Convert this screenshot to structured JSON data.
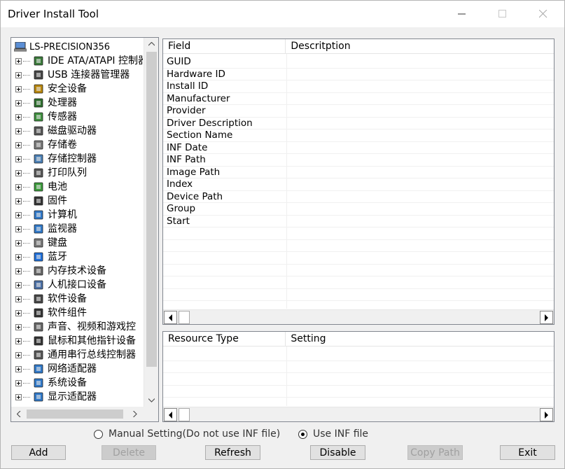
{
  "window": {
    "title": "Driver Install Tool"
  },
  "tree": {
    "root_label": "LS-PRECISION356",
    "items": [
      {
        "label": "IDE ATA/ATAPI 控制器",
        "icon": "ide-controller-icon"
      },
      {
        "label": "USB 连接器管理器",
        "icon": "usb-icon"
      },
      {
        "label": "安全设备",
        "icon": "security-device-icon"
      },
      {
        "label": "处理器",
        "icon": "processor-icon"
      },
      {
        "label": "传感器",
        "icon": "sensor-icon"
      },
      {
        "label": "磁盘驱动器",
        "icon": "disk-drive-icon"
      },
      {
        "label": "存储卷",
        "icon": "storage-volume-icon"
      },
      {
        "label": "存储控制器",
        "icon": "storage-controller-icon"
      },
      {
        "label": "打印队列",
        "icon": "printer-icon"
      },
      {
        "label": "电池",
        "icon": "battery-icon"
      },
      {
        "label": "固件",
        "icon": "firmware-icon"
      },
      {
        "label": "计算机",
        "icon": "computer-icon"
      },
      {
        "label": "监视器",
        "icon": "monitor-icon"
      },
      {
        "label": "键盘",
        "icon": "keyboard-icon"
      },
      {
        "label": "蓝牙",
        "icon": "bluetooth-icon"
      },
      {
        "label": "内存技术设备",
        "icon": "memory-device-icon"
      },
      {
        "label": "人机接口设备",
        "icon": "hid-icon"
      },
      {
        "label": "软件设备",
        "icon": "software-device-icon"
      },
      {
        "label": "软件组件",
        "icon": "software-component-icon"
      },
      {
        "label": "声音、视频和游戏控",
        "icon": "sound-icon"
      },
      {
        "label": "鼠标和其他指针设备",
        "icon": "mouse-icon"
      },
      {
        "label": "通用串行总线控制器",
        "icon": "usb-controller-icon"
      },
      {
        "label": "网络适配器",
        "icon": "network-adapter-icon"
      },
      {
        "label": "系统设备",
        "icon": "system-device-icon"
      },
      {
        "label": "显示适配器",
        "icon": "display-adapter-icon"
      }
    ]
  },
  "details": {
    "columns": [
      "Field",
      "Descritption"
    ],
    "rows": [
      "GUID",
      "Hardware ID",
      "Install ID",
      "Manufacturer",
      "Provider",
      "Driver Description",
      "Section Name",
      "INF Date",
      "INF Path",
      "Image Path",
      "Index",
      "Device Path",
      "Group",
      "Start"
    ]
  },
  "resources": {
    "columns": [
      "Resource Type",
      "Setting"
    ]
  },
  "options": {
    "manual_label": "Manual Setting(Do not use INF file)",
    "inf_label": "Use INF file",
    "selected": "Use INF file"
  },
  "buttons": {
    "add": "Add",
    "delete": "Delete",
    "refresh": "Refresh",
    "disable": "Disable",
    "copy_path": "Copy Path",
    "exit": "Exit"
  }
}
